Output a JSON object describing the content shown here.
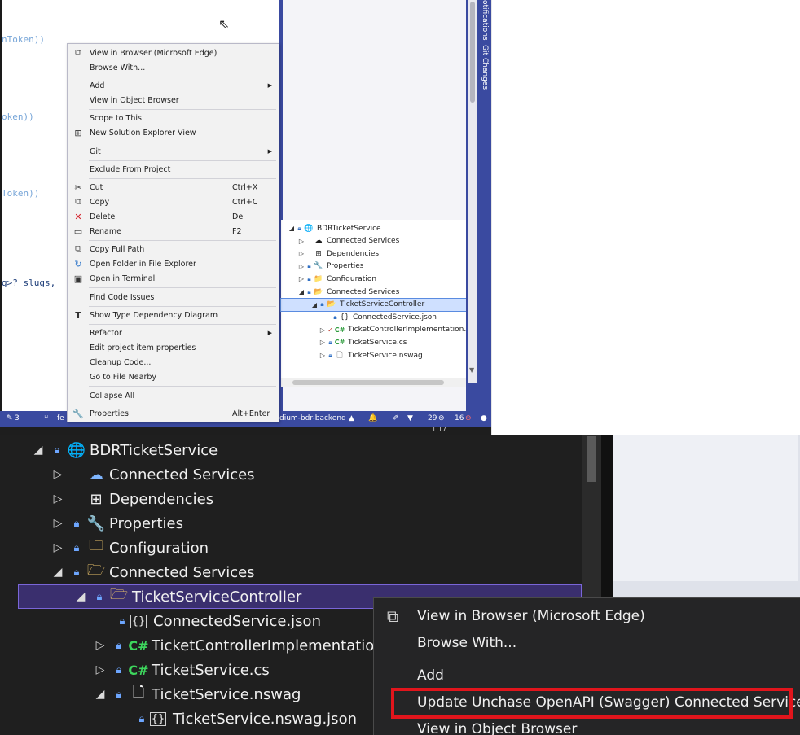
{
  "top": {
    "code_fragments": [
      "nToken))",
      "oken))",
      "Token))",
      "g>? slugs,"
    ],
    "vertical_tabs": [
      "otifications",
      "Git Changes"
    ],
    "solution_tree": [
      {
        "toggle": "◢",
        "lock": true,
        "icon": "globe-project-icon",
        "glyph": "🌐",
        "label": "BDRTicketService"
      },
      {
        "toggle": "▷",
        "lock": false,
        "icon": "cloud-icon",
        "glyph": "☁",
        "label": "Connected Services"
      },
      {
        "toggle": "▷",
        "lock": false,
        "icon": "dependencies-icon",
        "glyph": "⊞",
        "label": "Dependencies"
      },
      {
        "toggle": "▷",
        "lock": true,
        "icon": "wrench-icon",
        "glyph": "🔧",
        "label": "Properties"
      },
      {
        "toggle": "▷",
        "lock": true,
        "icon": "folder-icon",
        "glyph": "📁",
        "label": "Configuration"
      },
      {
        "toggle": "◢",
        "lock": true,
        "icon": "folder-open-icon",
        "glyph": "📂",
        "label": "Connected Services"
      },
      {
        "toggle": "◢",
        "lock": true,
        "icon": "folder-open-icon",
        "glyph": "📂",
        "label": "TicketServiceController"
      },
      {
        "toggle": "",
        "lock": true,
        "icon": "json-icon",
        "glyph": "{}",
        "label": "ConnectedService.json"
      },
      {
        "toggle": "▷",
        "lock": false,
        "icon": "csharp-icon",
        "glyph": "C#",
        "label": "TicketControllerImplementation."
      },
      {
        "toggle": "▷",
        "lock": true,
        "icon": "csharp-icon",
        "glyph": "C#",
        "label": "TicketService.cs"
      },
      {
        "toggle": "▷",
        "lock": true,
        "icon": "file-icon",
        "glyph": "🗋",
        "label": "TicketService.nswag"
      }
    ],
    "status": {
      "edits": "3",
      "branch_prefix": "fe",
      "repo": "dium-bdr-backend",
      "warnings": "29",
      "errors": "16",
      "time": "1:17"
    },
    "context_menu": {
      "view_in_browser": "View in Browser (Microsoft Edge)",
      "browse_with": "Browse With...",
      "add": "Add",
      "view_object_browser": "View in Object Browser",
      "scope_to_this": "Scope to This",
      "new_se_view": "New Solution Explorer View",
      "git": "Git",
      "exclude": "Exclude From Project",
      "cut": "Cut",
      "cut_sc": "Ctrl+X",
      "copy": "Copy",
      "copy_sc": "Ctrl+C",
      "delete": "Delete",
      "delete_sc": "Del",
      "rename": "Rename",
      "rename_sc": "F2",
      "copy_full_path": "Copy Full Path",
      "open_folder": "Open Folder in File Explorer",
      "open_terminal": "Open in Terminal",
      "find_code_issues": "Find Code Issues",
      "show_type_dep": "Show Type Dependency Diagram",
      "refactor": "Refactor",
      "edit_project_props": "Edit project item properties",
      "cleanup_code": "Cleanup Code...",
      "go_to_file_nearby": "Go to File Nearby",
      "collapse_all": "Collapse All",
      "properties": "Properties",
      "properties_sc": "Alt+Enter"
    }
  },
  "bottom": {
    "tree": [
      {
        "toggle": "◢",
        "lock": true,
        "icon": "globe-project-icon",
        "glyph": "🌐",
        "label": "BDRTicketService"
      },
      {
        "toggle": "▷",
        "lock": false,
        "icon": "cloud-icon",
        "glyph": "☁",
        "label": "Connected Services"
      },
      {
        "toggle": "▷",
        "lock": false,
        "icon": "dependencies-icon",
        "glyph": "⊞",
        "label": "Dependencies"
      },
      {
        "toggle": "▷",
        "lock": true,
        "icon": "wrench-icon",
        "glyph": "🔧",
        "label": "Properties"
      },
      {
        "toggle": "▷",
        "lock": true,
        "icon": "folder-icon",
        "glyph": "🗀",
        "label": "Configuration"
      },
      {
        "toggle": "◢",
        "lock": true,
        "icon": "folder-open-icon",
        "glyph": "🗁",
        "label": "Connected Services"
      },
      {
        "toggle": "◢",
        "lock": true,
        "icon": "folder-open-icon",
        "glyph": "🗁",
        "label": "TicketServiceController"
      },
      {
        "toggle": "",
        "lock": true,
        "icon": "json-icon",
        "glyph": "{}",
        "label": "ConnectedService.json"
      },
      {
        "toggle": "▷",
        "lock": true,
        "icon": "csharp-icon",
        "glyph": "C#",
        "label": "TicketControllerImplementation.cs"
      },
      {
        "toggle": "▷",
        "lock": true,
        "icon": "csharp-icon",
        "glyph": "C#",
        "label": "TicketService.cs"
      },
      {
        "toggle": "◢",
        "lock": true,
        "icon": "file-icon",
        "glyph": "🗋",
        "label": "TicketService.nswag"
      },
      {
        "toggle": "",
        "lock": true,
        "icon": "json-icon",
        "glyph": "{}",
        "label": "TicketService.nswag.json"
      }
    ],
    "context_menu": {
      "view_in_browser": "View in Browser (Microsoft Edge)",
      "browse_with": "Browse With...",
      "add": "Add",
      "update_unchase": "Update Unchase OpenAPI (Swagger) Connected Service...",
      "view_object_browser": "View in Object Browser"
    },
    "highlight_color": "#e1151c"
  }
}
